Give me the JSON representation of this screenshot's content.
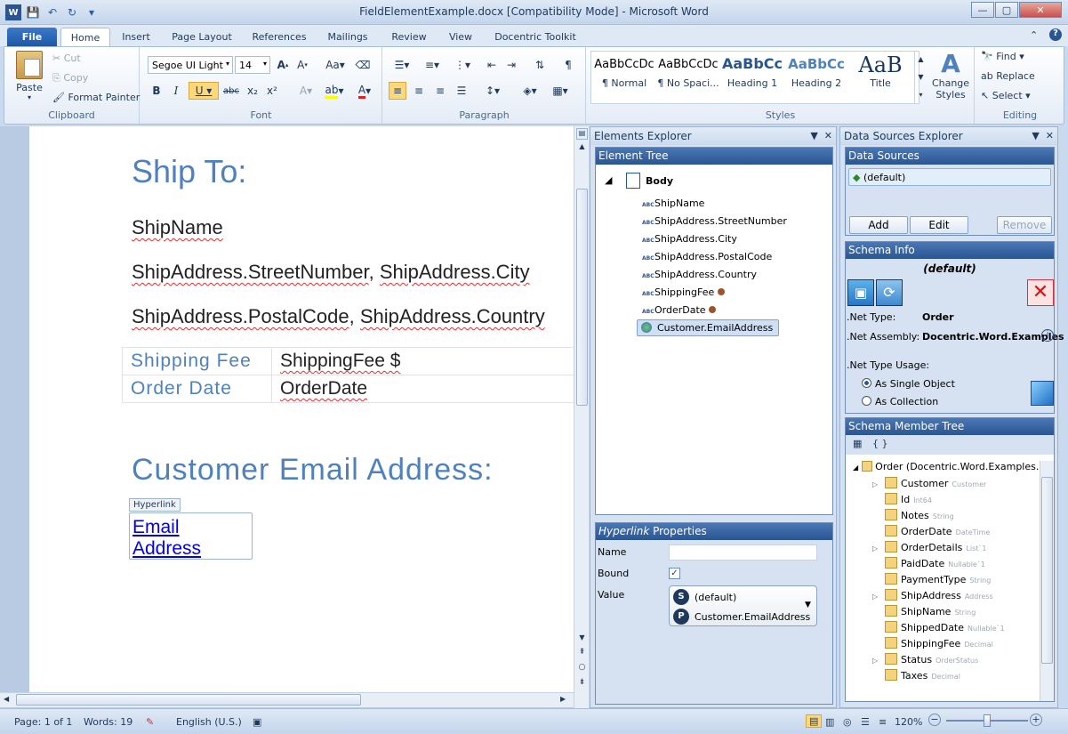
{
  "window": {
    "title": "FieldElementExample.docx [Compatibility Mode] - Microsoft Word"
  },
  "tabs": [
    "File",
    "Home",
    "Insert",
    "Page Layout",
    "References",
    "Mailings",
    "Review",
    "View",
    "Docentric Toolkit"
  ],
  "ribbon": {
    "clipboard": {
      "label": "Clipboard",
      "paste": "Paste",
      "cut": "Cut",
      "copy": "Copy",
      "format_painter": "Format Painter"
    },
    "font": {
      "label": "Font",
      "font_name": "Segoe UI Light",
      "font_size": "14"
    },
    "paragraph": {
      "label": "Paragraph"
    },
    "styles": {
      "label": "Styles",
      "items": [
        {
          "sample": "AaBbCcDc",
          "name": "¶ Normal"
        },
        {
          "sample": "AaBbCcDc",
          "name": "¶ No Spaci..."
        },
        {
          "sample": "AaBbCc",
          "name": "Heading 1"
        },
        {
          "sample": "AaBbCc",
          "name": "Heading 2"
        },
        {
          "sample": "AaB",
          "name": "Title"
        }
      ],
      "change_styles": "Change Styles"
    },
    "editing": {
      "label": "Editing",
      "find": "Find",
      "replace": "Replace",
      "select": "Select"
    }
  },
  "document": {
    "ship_to": "Ship To:",
    "ship_name": "ShipName",
    "line2_a": "ShipAddress.StreetNumber",
    "line2_sep": ",",
    "line2_b": "ShipAddress.City",
    "line3_a": "ShipAddress.PostalCode",
    "line3_sep": ",",
    "line3_b": "ShipAddress.Country",
    "table": [
      {
        "label": "Shipping Fee",
        "value": "ShippingFee $"
      },
      {
        "label": "Order Date",
        "value": "OrderDate"
      }
    ],
    "email_heading": "Customer Email Address:",
    "hyperlink_tag": "Hyperlink",
    "email_link": "Email Address"
  },
  "elements_explorer": {
    "title": "Elements Explorer",
    "tree_header": "Element Tree",
    "root": "Body",
    "items": [
      "ShipName",
      "ShipAddress.StreetNumber",
      "ShipAddress.City",
      "ShipAddress.PostalCode",
      "ShipAddress.Country",
      "ShippingFee",
      "OrderDate",
      "Customer.EmailAddress"
    ],
    "properties_title": "Hyperlink",
    "properties_suffix": "Properties",
    "name_label": "Name",
    "bound_label": "Bound",
    "value_label": "Value",
    "value_source": "(default)",
    "value_path": "Customer.EmailAddress"
  },
  "data_sources_explorer": {
    "title": "Data Sources Explorer",
    "sources_header": "Data Sources",
    "default_source": "(default)",
    "add": "Add",
    "edit": "Edit",
    "remove": "Remove",
    "schema_header": "Schema Info",
    "schema_name": "(default)",
    "net_type_label": ".Net Type:",
    "net_type": "Order",
    "net_assembly_label": ".Net Assembly:",
    "net_assembly": "Docentric.Word.Examples",
    "usage_label": ".Net Type Usage:",
    "usage_single": "As Single Object",
    "usage_collection": "As Collection",
    "member_tree_header": "Schema Member Tree",
    "member_root": "Order (Docentric.Word.Examples.D",
    "members": [
      {
        "name": "Customer",
        "type": "Customer",
        "expand": true
      },
      {
        "name": "Id",
        "type": "Int64",
        "expand": false
      },
      {
        "name": "Notes",
        "type": "String",
        "expand": false
      },
      {
        "name": "OrderDate",
        "type": "DateTime",
        "expand": false
      },
      {
        "name": "OrderDetails",
        "type": "List`1",
        "expand": true
      },
      {
        "name": "PaidDate",
        "type": "Nullable`1",
        "expand": false
      },
      {
        "name": "PaymentType",
        "type": "String",
        "expand": false
      },
      {
        "name": "ShipAddress",
        "type": "Address",
        "expand": true
      },
      {
        "name": "ShipName",
        "type": "String",
        "expand": false
      },
      {
        "name": "ShippedDate",
        "type": "Nullable`1",
        "expand": false
      },
      {
        "name": "ShippingFee",
        "type": "Decimal",
        "expand": false
      },
      {
        "name": "Status",
        "type": "OrderStatus",
        "expand": true
      },
      {
        "name": "Taxes",
        "type": "Decimal",
        "expand": false
      }
    ]
  },
  "status": {
    "page": "Page: 1 of 1",
    "words": "Words: 19",
    "language": "English (U.S.)",
    "zoom": "120%"
  },
  "colors": {
    "accent": "#2a5593",
    "heading": "#4f81bd",
    "file_tab": "#1f57a8"
  }
}
